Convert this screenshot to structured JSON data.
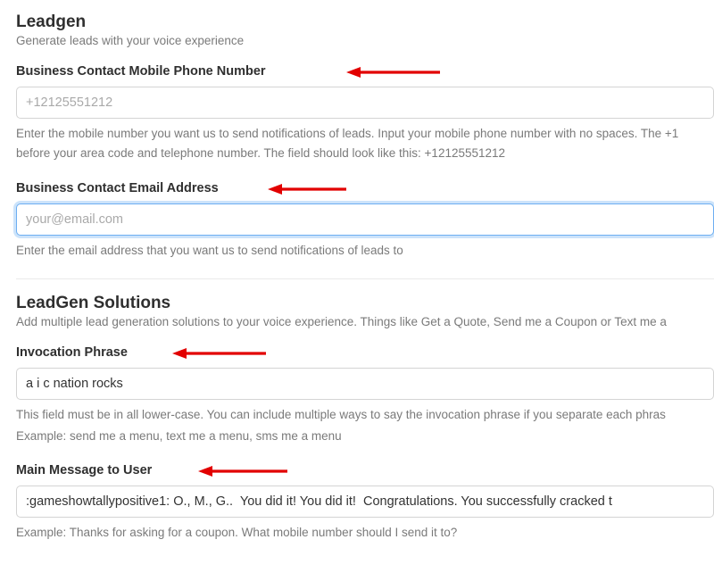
{
  "leadgen": {
    "title": "Leadgen",
    "desc": "Generate leads with your voice experience",
    "phone": {
      "label": "Business Contact Mobile Phone Number",
      "placeholder": "+12125551212",
      "help": "Enter the mobile number you want us to send notifications of leads. Input your mobile phone number with no spaces. The +1 before your area code and telephone number. The field should look like this: +12125551212"
    },
    "email": {
      "label": "Business Contact Email Address",
      "placeholder": "your@email.com",
      "help": "Enter the email address that you want us to send notifications of leads to"
    }
  },
  "solutions": {
    "title": "LeadGen Solutions",
    "desc": "Add multiple lead generation solutions to your voice experience. Things like Get a Quote, Send me a Coupon or Text me a",
    "invocation": {
      "label": "Invocation Phrase",
      "value": "a i c nation rocks",
      "help1": "This field must be in all lower-case. You can include multiple ways to say the invocation phrase if you separate each phras",
      "help2": "Example: send me a menu, text me a menu, sms me a menu"
    },
    "mainmsg": {
      "label": "Main Message to User",
      "value": ":gameshowtallypositive1: O., M., G..  You did it! You did it!  Congratulations. You successfully cracked t",
      "help": "Example: Thanks for asking for a coupon. What mobile number should I send it to?"
    }
  }
}
